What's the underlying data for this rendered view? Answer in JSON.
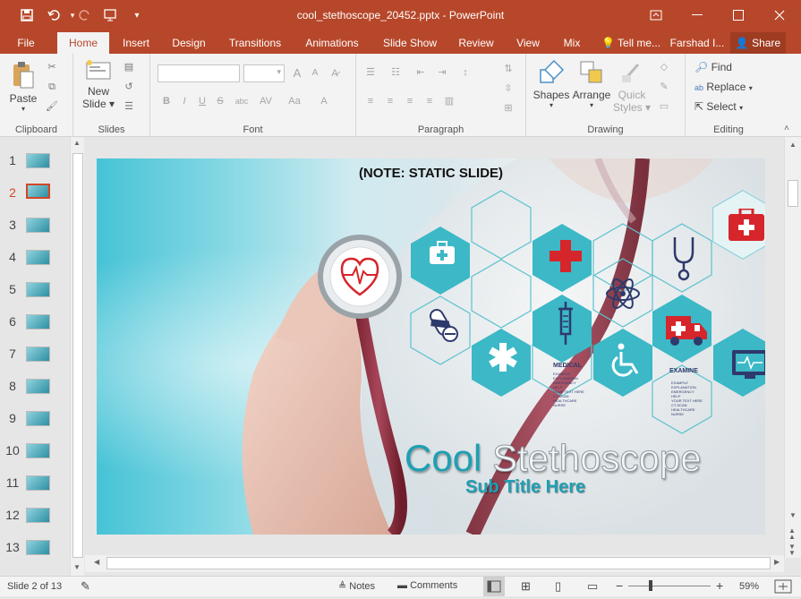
{
  "app": {
    "window_title": "cool_stethoscope_20452.pptx - PowerPoint",
    "accent": "#b7472a"
  },
  "tabs": [
    {
      "label": "File"
    },
    {
      "label": "Home"
    },
    {
      "label": "Insert"
    },
    {
      "label": "Design"
    },
    {
      "label": "Transitions"
    },
    {
      "label": "Animations"
    },
    {
      "label": "Slide Show"
    },
    {
      "label": "Review"
    },
    {
      "label": "View"
    },
    {
      "label": "Mix"
    }
  ],
  "tell_me": "Tell me...",
  "user": "Farshad I...",
  "share": "Share",
  "ribbon": {
    "clipboard": {
      "paste": "Paste",
      "label": "Clipboard"
    },
    "slides": {
      "new_slide_1": "New",
      "new_slide_2": "Slide",
      "label": "Slides"
    },
    "font": {
      "bold": "B",
      "italic": "I",
      "underline": "U",
      "strike": "S",
      "shadow": "abc",
      "spacing": "AV",
      "case": "Aa",
      "color": "A",
      "label": "Font"
    },
    "paragraph": {
      "label": "Paragraph"
    },
    "drawing": {
      "shapes": "Shapes",
      "arrange": "Arrange",
      "quick1": "Quick",
      "quick2": "Styles",
      "label": "Drawing"
    },
    "editing": {
      "find": "Find",
      "replace": "Replace",
      "select": "Select",
      "label": "Editing"
    }
  },
  "thumbnails": [
    "1",
    "2",
    "3",
    "4",
    "5",
    "6",
    "7",
    "8",
    "9",
    "10",
    "11",
    "12",
    "13"
  ],
  "selected_slide": 2,
  "slide": {
    "note": "(NOTE: STATIC SLIDE)",
    "title_part1": "Cool",
    "title_part2": "Stethoscope",
    "subtitle": "Sub Title Here",
    "medical_heading": "MEDICAL",
    "medical_lines": [
      "EXAMPLE",
      "EXPLANATION",
      "EMERGENCY",
      "HELP",
      "YOUR TEXT HERE",
      "CT-SCAN",
      "HEALTHCARE",
      "NURSE"
    ],
    "examine_heading": "EXAMINE",
    "examine_lines": [
      "EXAMPLE",
      "EXPLANATION",
      "EMERGENCY",
      "HELP",
      "YOUR TEXT HERE",
      "CT-SCAN",
      "HEALTHCARE",
      "NURSE"
    ]
  },
  "status": {
    "slide_of": "Slide 2 of 13",
    "notes": "Notes",
    "comments": "Comments",
    "zoom": "59%",
    "zoom_level": 0.59
  }
}
